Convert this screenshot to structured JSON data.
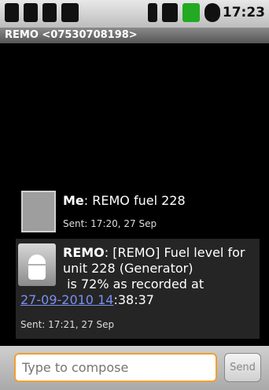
{
  "status_bar": {
    "time": "17:23",
    "left_icons": [
      "bag-icon",
      "briefcase-icon",
      "usb-icon",
      "battery-icon"
    ],
    "right_icons": [
      "wifi-icon",
      "signal-icon",
      "battery-charging-icon",
      "alarm-icon"
    ]
  },
  "header": {
    "title": "REMO <07530708198>"
  },
  "messages": [
    {
      "sender": "Me",
      "text": "REMO fuel 228",
      "sent": "Sent: 17:20, 27 Sep"
    },
    {
      "sender": "REMO",
      "text_line1": "[REMO] Fuel level for",
      "text_line2": "unit 228 (Generator)",
      "text_line3": " is 72% as recorded at",
      "link": "27-09-2010 14",
      "link_tail": ":38:37",
      "sent": "Sent: 17:21, 27 Sep"
    }
  ],
  "composer": {
    "placeholder": "Type to compose",
    "send_label": "Send"
  },
  "colors": {
    "link": "#7b8ef0",
    "input_border": "#f0a030"
  }
}
